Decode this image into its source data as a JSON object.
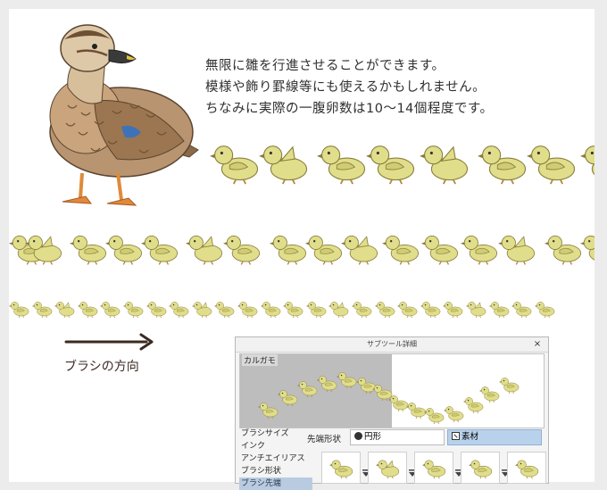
{
  "note": {
    "line1": "無限に雛を行進させることができます。",
    "line2": "模様や飾り罫線等にも使えるかもしれません。",
    "line3": "ちなみに実際の一腹卵数は10～14個程度です。"
  },
  "direction_label": "ブラシの方向",
  "panel": {
    "title": "サブツール詳細",
    "close": "×",
    "preview_name": "カルガモ",
    "categories": [
      "ブラシサイズ",
      "インク",
      "アンチエイリアス",
      "ブラシ形状",
      "ブラシ先端"
    ],
    "selected_category": "ブラシ先端",
    "tip_shape_label": "先端形状",
    "tip_circle_label": "円形",
    "tip_material_label": "素材",
    "tip_selected": "素材"
  },
  "colors": {
    "duckling_body": "#e0de8a",
    "duckling_outline": "#8a7f3e",
    "duck_brown": "#9b7650",
    "duck_feet": "#e08a3a",
    "arrow": "#3b2a22",
    "panel_selected": "#b9d2ec"
  }
}
